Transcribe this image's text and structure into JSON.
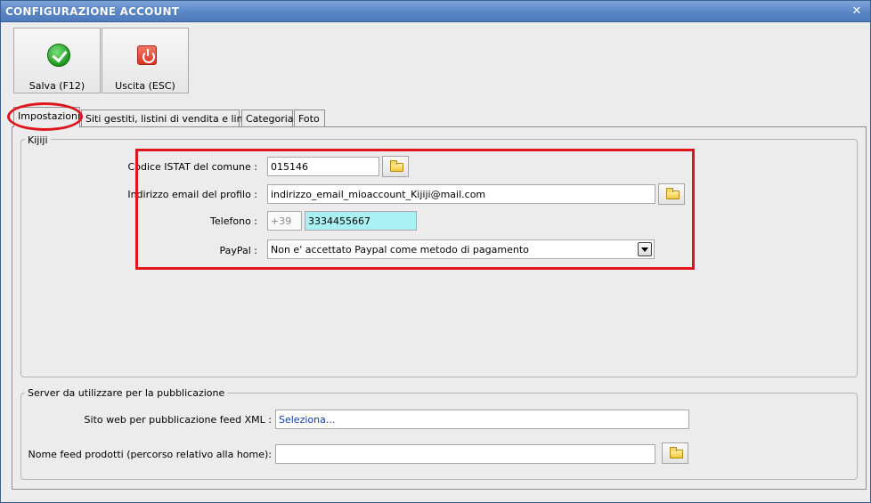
{
  "window": {
    "title": "CONFIGURAZIONE ACCOUNT",
    "close_glyph": "✕"
  },
  "toolbar": {
    "save": {
      "label": "Salva (F12)",
      "icon": "checkmark-icon"
    },
    "exit": {
      "label": "Uscita (ESC)",
      "icon": "power-icon"
    }
  },
  "tabs": [
    {
      "label": "Impostazioni",
      "active": true
    },
    {
      "label": "Siti gestiti, listini di vendita e lingue",
      "active": false
    },
    {
      "label": "Categoria",
      "active": false
    },
    {
      "label": "Foto",
      "active": false
    }
  ],
  "kijiji": {
    "legend": "Kijiji",
    "istat": {
      "label": "Codice ISTAT del comune :",
      "value": "015146"
    },
    "email": {
      "label": "Indirizzo email del profilo :",
      "value": "indirizzo_email_mioaccount_Kijiji@mail.com"
    },
    "phone": {
      "label": "Telefono :",
      "prefix": "+39",
      "value": "3334455667"
    },
    "paypal": {
      "label": "PayPal :",
      "selected": "Non e' accettato Paypal come metodo di pagamento"
    }
  },
  "server": {
    "legend": "Server da utilizzare per la pubblicazione",
    "site": {
      "label": "Sito web per pubblicazione feed XML :",
      "value": "Seleziona..."
    },
    "feed": {
      "label": "Nome feed prodotti (percorso relativo alla home):",
      "value": ""
    }
  },
  "colors": {
    "titlebar": "#5a86c6",
    "highlight_annotation": "#e0151b",
    "phone_field": "#aaf1f4",
    "link_text": "#0b3ea8"
  }
}
